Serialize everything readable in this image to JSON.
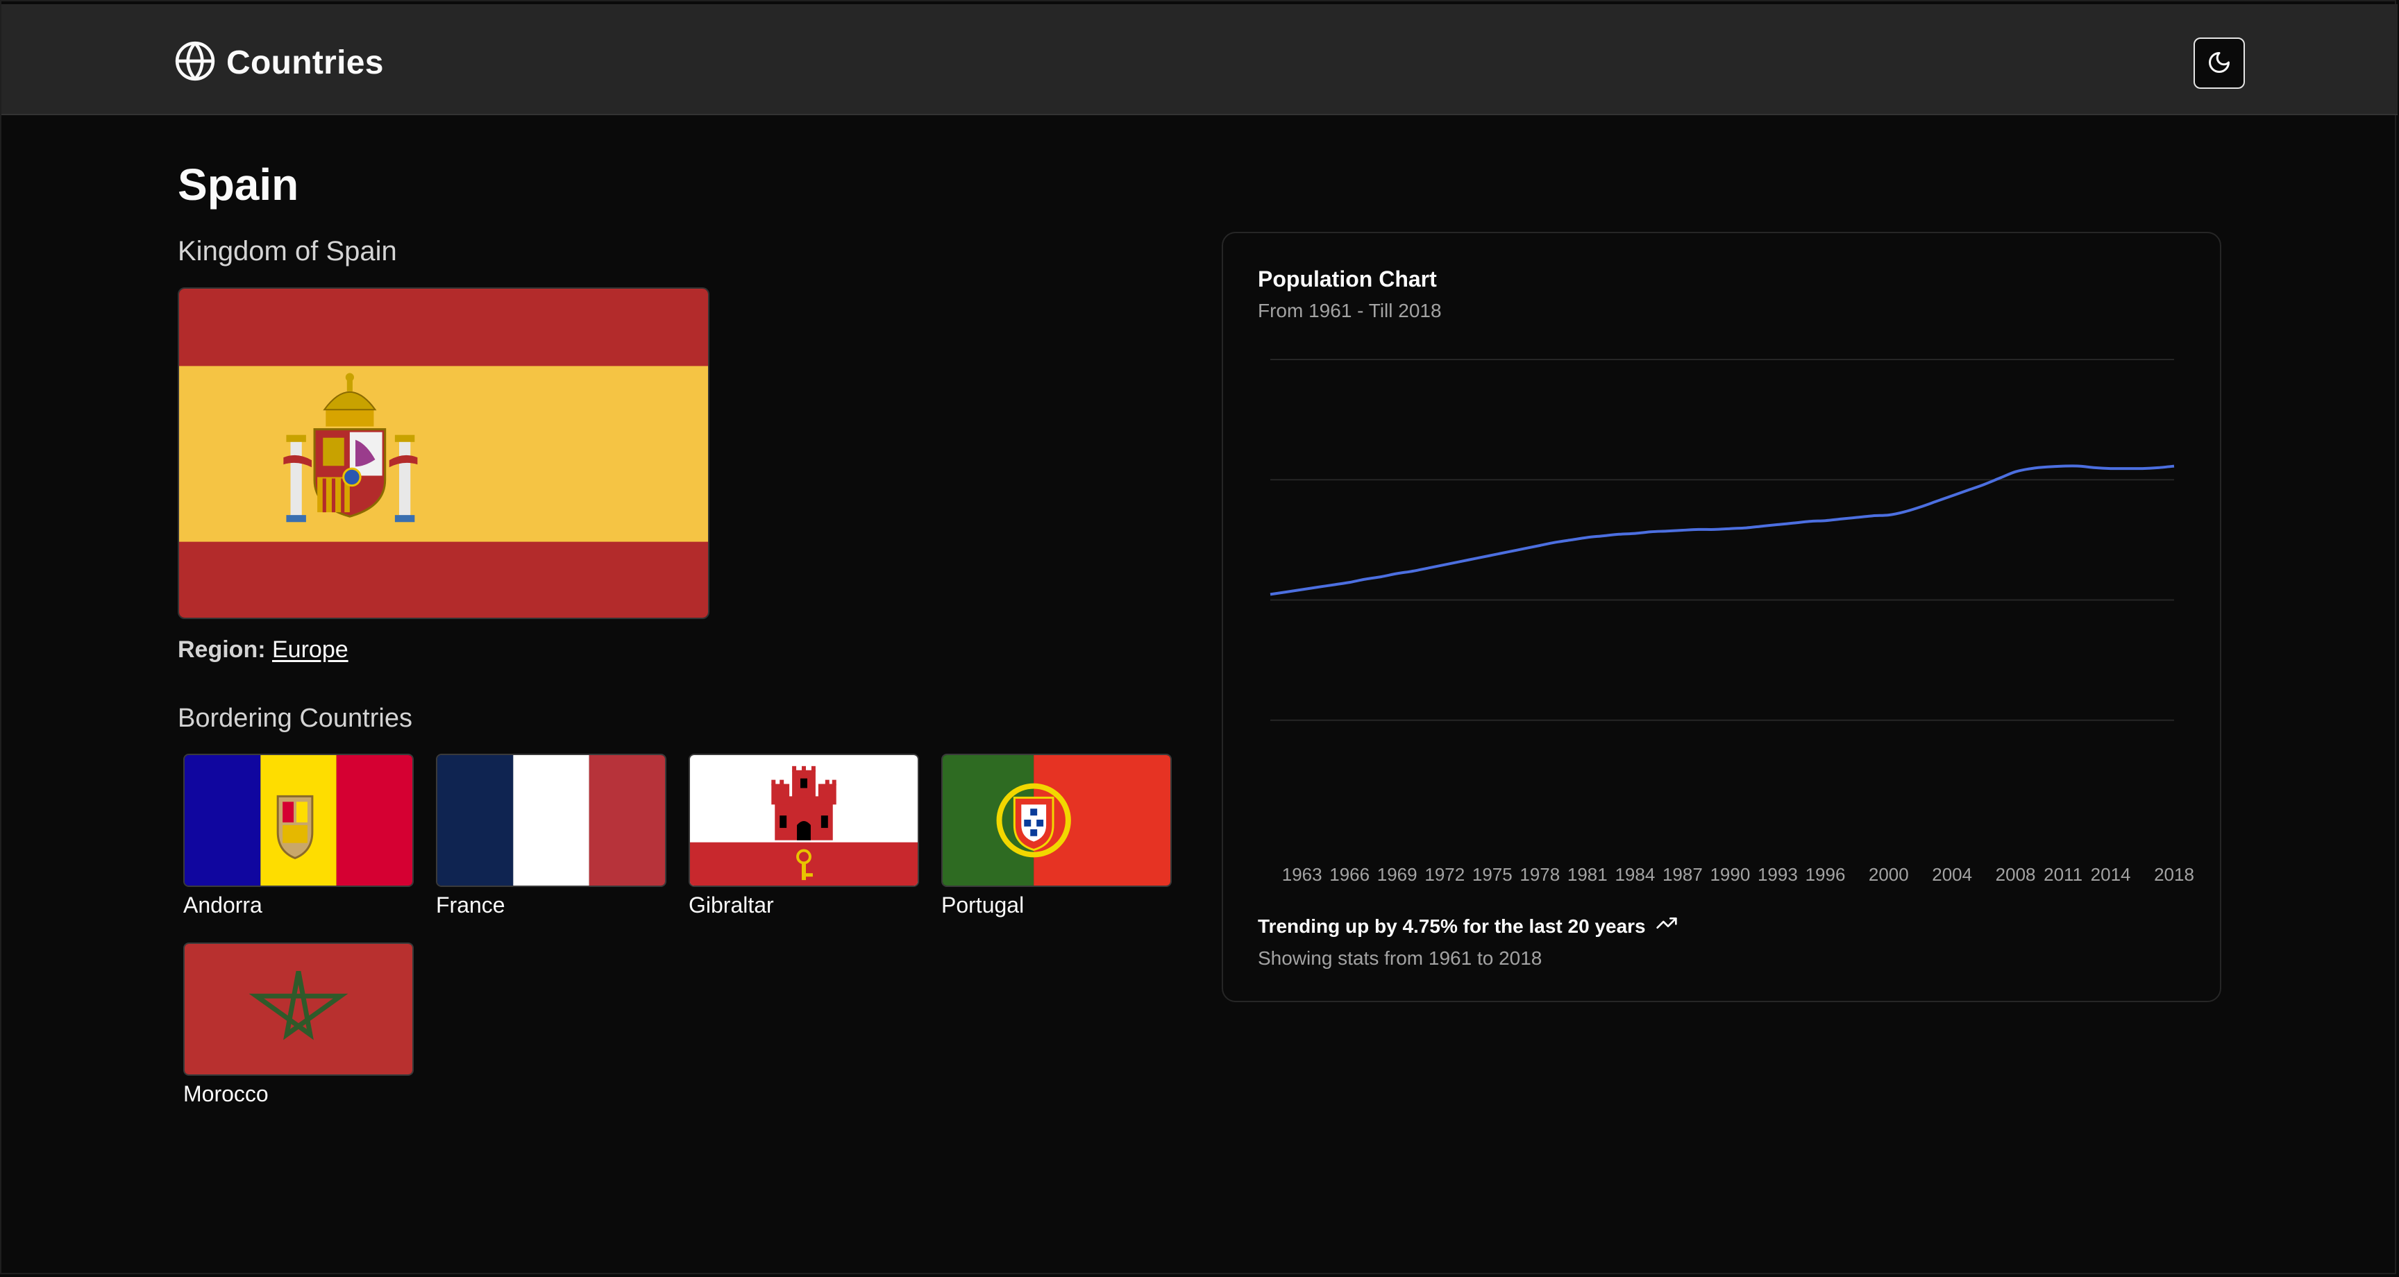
{
  "header": {
    "app_title": "Countries",
    "logo_icon": "globe-icon",
    "theme_toggle_icon": "moon-icon"
  },
  "country": {
    "common_name": "Spain",
    "official_name": "Kingdom of Spain",
    "region_label": "Region:",
    "region": "Europe",
    "flag": {
      "name": "spain-flag",
      "colors": {
        "red": "#B32B2B",
        "yellow": "#F5C444"
      }
    }
  },
  "bordering": {
    "heading": "Bordering Countries",
    "countries": [
      {
        "name": "Andorra",
        "flag_colors": [
          "#10069F",
          "#FEDD00",
          "#D50032"
        ]
      },
      {
        "name": "France",
        "flag_colors": [
          "#002654",
          "#FFFFFF",
          "#CE1126"
        ]
      },
      {
        "name": "Gibraltar",
        "flag_colors": [
          "#FFFFFF",
          "#DA000C"
        ]
      },
      {
        "name": "Portugal",
        "flag_colors": [
          "#046A38",
          "#DA291C",
          "#FFE900"
        ]
      },
      {
        "name": "Morocco",
        "flag_colors": [
          "#C1272D",
          "#006233"
        ]
      }
    ]
  },
  "chart": {
    "title": "Population Chart",
    "subtitle": "From 1961 - Till 2018",
    "trend_text": "Trending up by 4.75% for the last 20 years",
    "trend_icon": "trending-up-icon",
    "footer_text": "Showing stats from 1961 to 2018",
    "line_color": "#4C6FE0"
  },
  "chart_data": {
    "type": "line",
    "x": [
      1961,
      1962,
      1963,
      1964,
      1965,
      1966,
      1967,
      1968,
      1969,
      1970,
      1971,
      1972,
      1973,
      1974,
      1975,
      1976,
      1977,
      1978,
      1979,
      1980,
      1981,
      1982,
      1983,
      1984,
      1985,
      1986,
      1987,
      1988,
      1989,
      1990,
      1991,
      1992,
      1993,
      1994,
      1995,
      1996,
      1997,
      1998,
      1999,
      2000,
      2001,
      2002,
      2003,
      2004,
      2005,
      2006,
      2007,
      2008,
      2009,
      2010,
      2011,
      2012,
      2013,
      2014,
      2015,
      2016,
      2017,
      2018
    ],
    "y": [
      30.7,
      31.0,
      31.3,
      31.6,
      31.9,
      32.2,
      32.6,
      32.9,
      33.3,
      33.6,
      34.0,
      34.4,
      34.8,
      35.2,
      35.6,
      36.0,
      36.4,
      36.8,
      37.2,
      37.5,
      37.8,
      38.0,
      38.2,
      38.3,
      38.5,
      38.6,
      38.7,
      38.8,
      38.8,
      38.9,
      39.0,
      39.2,
      39.4,
      39.6,
      39.8,
      39.9,
      40.1,
      40.3,
      40.5,
      40.6,
      41.0,
      41.6,
      42.3,
      43.0,
      43.7,
      44.4,
      45.2,
      46.0,
      46.4,
      46.6,
      46.7,
      46.7,
      46.5,
      46.4,
      46.4,
      46.4,
      46.5,
      46.7
    ],
    "x_tick_labels": [
      "1963",
      "1966",
      "1969",
      "1972",
      "1975",
      "1978",
      "1981",
      "1984",
      "1987",
      "1990",
      "1993",
      "1996",
      "2000",
      "2004",
      "2008",
      "2011",
      "2014",
      "2018"
    ],
    "ylim": [
      0,
      60
    ],
    "grid": "horizontal",
    "legend": "none",
    "title": "Population Chart",
    "xlabel": "",
    "ylabel": ""
  }
}
